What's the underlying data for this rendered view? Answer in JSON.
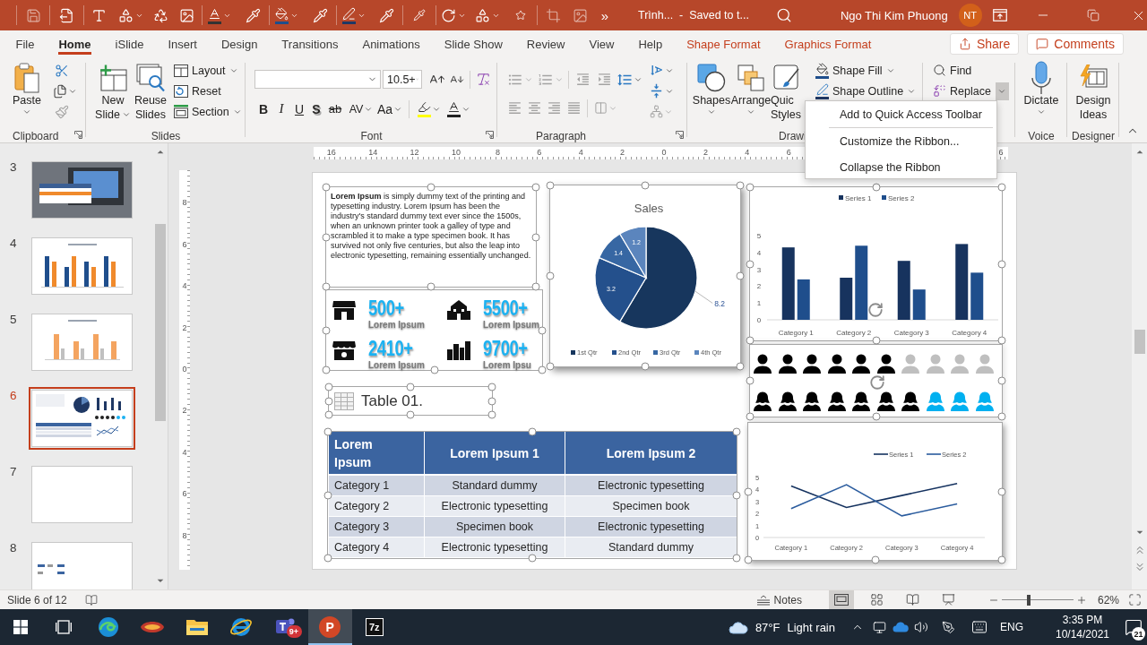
{
  "title_bar": {
    "overflow": "»",
    "document": "Trình...  -  Saved to t...",
    "user": "Ngo Thi Kim Phuong",
    "initials": "NT"
  },
  "tabs": [
    {
      "label": "File",
      "kind": "standard",
      "selected": false
    },
    {
      "label": "Home",
      "kind": "standard",
      "selected": true
    },
    {
      "label": "iSlide",
      "kind": "standard",
      "selected": false
    },
    {
      "label": "Insert",
      "kind": "standard",
      "selected": false
    },
    {
      "label": "Design",
      "kind": "standard",
      "selected": false
    },
    {
      "label": "Transitions",
      "kind": "standard",
      "selected": false
    },
    {
      "label": "Animations",
      "kind": "standard",
      "selected": false
    },
    {
      "label": "Slide Show",
      "kind": "standard",
      "selected": false
    },
    {
      "label": "Review",
      "kind": "standard",
      "selected": false
    },
    {
      "label": "View",
      "kind": "standard",
      "selected": false
    },
    {
      "label": "Help",
      "kind": "standard",
      "selected": false
    },
    {
      "label": "Shape Format",
      "kind": "contextual",
      "selected": false
    },
    {
      "label": "Graphics Format",
      "kind": "contextual",
      "selected": false
    }
  ],
  "share": "Share",
  "comments": "Comments",
  "ribbon": {
    "clipboard": {
      "label": "Clipboard",
      "paste": "Paste"
    },
    "slides": {
      "label": "Slides",
      "new_slide": [
        "New",
        "Slide"
      ],
      "reuse_slides": [
        "Reuse",
        "Slides"
      ],
      "layout": "Layout",
      "reset": "Reset",
      "section": "Section"
    },
    "font": {
      "label": "Font",
      "size": "10.5+",
      "format_buttons": [
        {
          "label": "B",
          "kind": "bold"
        },
        {
          "label": "I",
          "kind": "italic"
        },
        {
          "label": "U",
          "kind": "underline"
        },
        {
          "label": "S",
          "kind": "shadow"
        },
        {
          "label": "ab",
          "kind": "strikethrough"
        },
        {
          "label": "AV",
          "kind": "spacing"
        },
        {
          "label": "Aa",
          "kind": "case"
        }
      ]
    },
    "paragraph": {
      "label": "Paragraph"
    },
    "drawing": {
      "label": "Drawi",
      "shapes": "Shapes",
      "arrange": "Arrange",
      "quick_styles": [
        "Quic",
        "Styles"
      ],
      "shape_fill": "Shape Fill",
      "shape_outline": "Shape Outline"
    },
    "editing": {
      "find": "Find",
      "replace": "Replace",
      "replace_arrow_highlighted": true
    },
    "voice": {
      "label": "Voice",
      "dictate": "Dictate"
    },
    "designer": {
      "label": "Designer",
      "design_ideas": [
        "Design",
        "Ideas"
      ]
    }
  },
  "context_menu": [
    {
      "kind": "command",
      "label": "Add to Quick Access Toolbar"
    },
    {
      "kind": "separator"
    },
    {
      "kind": "command",
      "label": "Customize the Ribbon..."
    },
    {
      "kind": "command",
      "label": "Collapse the Ribbon"
    }
  ],
  "ruler": {
    "labels": [
      "16",
      "14",
      "12",
      "10",
      "8",
      "6",
      "4",
      "2",
      "0",
      "2",
      "4",
      "6"
    ],
    "trailing_label": "6",
    "vertical_labels": [
      "8",
      "6",
      "4",
      "2",
      "0",
      "2",
      "4",
      "6",
      "8"
    ]
  },
  "thumbnails": [
    {
      "number": "3",
      "kind": "photo",
      "selected": false
    },
    {
      "number": "4",
      "kind": "blue-bars",
      "selected": false
    },
    {
      "number": "5",
      "kind": "orange-bars",
      "selected": false
    },
    {
      "number": "6",
      "kind": "dashboard",
      "selected": true
    },
    {
      "number": "7",
      "kind": "blank",
      "selected": false
    },
    {
      "number": "8",
      "kind": "icons",
      "selected": false
    }
  ],
  "slide": {
    "intro": "**Lorem Ipsum** is simply dummy text of the printing and typesetting industry. Lorem Ipsum has been the industry's standard dummy text ever since the 1500s, when an unknown printer took a galley of type and scrambled it to make a type specimen book. It has survived not only five centuries, but also the leap into electronic typesetting, remaining essentially unchanged.",
    "stats": [
      {
        "kind": "store",
        "value": "500+",
        "caption": "Lorem Ipsum"
      },
      {
        "kind": "school",
        "value": "5500+",
        "caption": "Lorem Ipsum"
      },
      {
        "kind": "shop",
        "value": "2410+",
        "caption": "Lorem Ipsum"
      },
      {
        "kind": "city",
        "value": "9700+",
        "caption": "Lorem Ipsu"
      }
    ],
    "sales_chart": {
      "chart_data": {
        "type": "pie",
        "title": "Sales",
        "categories": [
          "1st Qtr",
          "2nd Qtr",
          "3rd Qtr",
          "4th Qtr"
        ],
        "series": [
          {
            "values": [
              8.2,
              3.2,
              1.4,
              1.2
            ]
          }
        ],
        "data_labels": true,
        "legend": "bottom"
      }
    },
    "bar_chart": {
      "chart_data": {
        "type": "bar",
        "categories": [
          "Category 1",
          "Category 2",
          "Category 3",
          "Category 4"
        ],
        "series": [
          {
            "name": "Series 1",
            "color": "#17335e",
            "values": [
              4.3,
              2.5,
              3.5,
              4.5
            ]
          },
          {
            "name": "Series 2",
            "color": "#1f4e8c",
            "values": [
              2.4,
              4.4,
              1.8,
              2.8
            ]
          }
        ],
        "ylim": [
          0,
          5
        ],
        "yticks": [
          0,
          1,
          2,
          3,
          4,
          5
        ],
        "legend": "top"
      }
    },
    "people_rows": [
      {
        "kind": "man",
        "figures": [
          {
            "color": "#000000"
          },
          {
            "color": "#000000"
          },
          {
            "color": "#000000"
          },
          {
            "color": "#000000"
          },
          {
            "color": "#000000"
          },
          {
            "color": "#000000"
          },
          {
            "color": "#bfbfbf"
          },
          {
            "color": "#bfbfbf"
          },
          {
            "color": "#bfbfbf"
          },
          {
            "color": "#bfbfbf"
          }
        ]
      },
      {
        "kind": "woman",
        "figures": [
          {
            "color": "#000000"
          },
          {
            "color": "#000000"
          },
          {
            "color": "#000000"
          },
          {
            "color": "#000000"
          },
          {
            "color": "#000000"
          },
          {
            "color": "#000000"
          },
          {
            "color": "#000000"
          },
          {
            "color": "#00b0f0"
          },
          {
            "color": "#00b0f0"
          },
          {
            "color": "#00b0f0"
          }
        ]
      }
    ],
    "table_title": "Table 01.",
    "table": {
      "columns": [
        "Lorem Ipsum",
        "Lorem Ipsum 1",
        "Lorem Ipsum 2"
      ],
      "rows": [
        [
          "Category 1",
          "Standard dummy",
          "Electronic typesetting"
        ],
        [
          "Category 2",
          "Electronic typesetting",
          "Specimen book"
        ],
        [
          "Category 3",
          "Specimen book",
          "Electronic typesetting"
        ],
        [
          "Category 4",
          "Electronic typesetting",
          "Standard dummy"
        ]
      ]
    },
    "line_chart": {
      "chart_data": {
        "type": "line",
        "categories": [
          "Category 1",
          "Category 2",
          "Category 3",
          "Category 4"
        ],
        "series": [
          {
            "name": "Series 1",
            "color": "#15325f",
            "values": [
              4.3,
              2.5,
              3.5,
              4.5
            ]
          },
          {
            "name": "Series 2",
            "color": "#2b5c9e",
            "values": [
              2.4,
              4.4,
              1.8,
              2.8
            ]
          }
        ],
        "ylim": [
          0,
          5
        ],
        "yticks": [
          0,
          1,
          2,
          3,
          4,
          5
        ],
        "legend": "top"
      }
    }
  },
  "status_bar": {
    "slide_info": "Slide 6 of 12",
    "notes": "Notes",
    "views": [
      {
        "kind": "normal",
        "selected": true
      },
      {
        "kind": "sorter",
        "selected": false
      },
      {
        "kind": "reading",
        "selected": false
      },
      {
        "kind": "slideshow",
        "selected": false
      }
    ],
    "zoom": {
      "level": 0.38,
      "reading": "62%"
    }
  },
  "taskbar": {
    "apps": [
      {
        "kind": "edge",
        "active": false
      },
      {
        "kind": "game",
        "active": false
      },
      {
        "kind": "explorer",
        "active": false
      },
      {
        "kind": "ie",
        "active": false
      },
      {
        "kind": "teams",
        "active": false,
        "badge": "9+"
      },
      {
        "kind": "powerpoint",
        "active": true,
        "label": "P"
      },
      {
        "kind": "archive",
        "active": false,
        "label": "7z"
      }
    ],
    "weather": {
      "temperature": "87°F",
      "condition": "Light rain"
    },
    "language": "ENG",
    "time": "3:35 PM",
    "date": "10/14/2021",
    "notifications": "21"
  }
}
